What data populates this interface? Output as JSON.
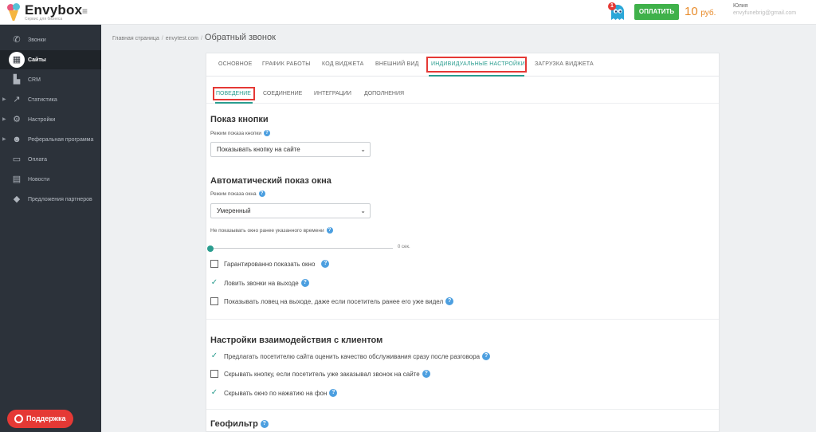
{
  "header": {
    "logo_name": "Envybox",
    "logo_tagline": "Сервис для бизнеса",
    "notification_count": "1",
    "pay_label": "ОПЛАТИТЬ",
    "balance_amount": "10",
    "balance_currency": "руб.",
    "user_name": "Юлия",
    "user_email": "envyfunebrig@gmail.com"
  },
  "sidebar": {
    "items": [
      {
        "label": "Звонки",
        "icon": "phone-icon",
        "active": false,
        "expandable": false
      },
      {
        "label": "Сайты",
        "icon": "grid-icon",
        "active": true,
        "expandable": false
      },
      {
        "label": "CRM",
        "icon": "crm-icon",
        "active": false,
        "expandable": false
      },
      {
        "label": "Статистика",
        "icon": "trend-icon",
        "active": false,
        "expandable": true
      },
      {
        "label": "Настройки",
        "icon": "gear-icon",
        "active": false,
        "expandable": true
      },
      {
        "label": "Реферальная программа",
        "icon": "people-icon",
        "active": false,
        "expandable": true
      },
      {
        "label": "Оплата",
        "icon": "card-icon",
        "active": false,
        "expandable": false
      },
      {
        "label": "Новости",
        "icon": "news-icon",
        "active": false,
        "expandable": false
      },
      {
        "label": "Предложения партнеров",
        "icon": "tag-icon",
        "active": false,
        "expandable": false
      }
    ],
    "support_label": "Поддержка"
  },
  "breadcrumb": {
    "home": "Главная страница",
    "site": "envytest.com",
    "current": "Обратный звонок"
  },
  "tabs": [
    "ОСНОВНОЕ",
    "ГРАФИК РАБОТЫ",
    "КОД ВИДЖЕТА",
    "ВНЕШНИЙ ВИД",
    "ИНДИВИДУАЛЬНЫЕ НАСТРОЙКИ",
    "ЗАГРУЗКА ВИДЖЕТА"
  ],
  "active_tab": "ИНДИВИДУАЛЬНЫЕ НАСТРОЙКИ",
  "subtabs": [
    "ПОВЕДЕНИЕ",
    "СОЕДИНЕНИЕ",
    "ИНТЕГРАЦИИ",
    "ДОПОЛНЕНИЯ"
  ],
  "active_subtab": "ПОВЕДЕНИЕ",
  "button_display": {
    "title": "Показ кнопки",
    "mode_label": "Режим показа кнопки",
    "mode_value": "Показывать кнопку на сайте"
  },
  "auto_show": {
    "title": "Автоматический показ окна",
    "mode_label": "Режим показа окна",
    "mode_value": "Умеренный",
    "delay_label": "Не показывать окно ранее указанного времени",
    "delay_value": "0 сек.",
    "delay_fraction": 0,
    "options": [
      {
        "label": "Гарантированно показать окно",
        "checked": false
      },
      {
        "label": "Ловить звонки на выходе",
        "checked": true
      },
      {
        "label": "Показывать ловец на выходе, даже если посетитель ранее его уже видел",
        "checked": false
      }
    ]
  },
  "client_interaction": {
    "title": "Настройки взаимодействия с клиентом",
    "options": [
      {
        "label": "Предлагать посетителю сайта оценить качество обслуживания сразу после разговора",
        "checked": true
      },
      {
        "label": "Скрывать кнопку, если посетитель уже заказывал звонок на сайте",
        "checked": false
      },
      {
        "label": "Скрывать окно по нажатию на фон",
        "checked": true
      }
    ]
  },
  "geofilter": {
    "title": "Геофильтр"
  },
  "colors": {
    "accent": "#2a9d8f",
    "highlight_box": "#e53935",
    "pay_button": "#3fb14a",
    "balance": "#e88b2a",
    "sidebar_bg": "#2c323a",
    "help_icon": "#4c9fe0"
  }
}
